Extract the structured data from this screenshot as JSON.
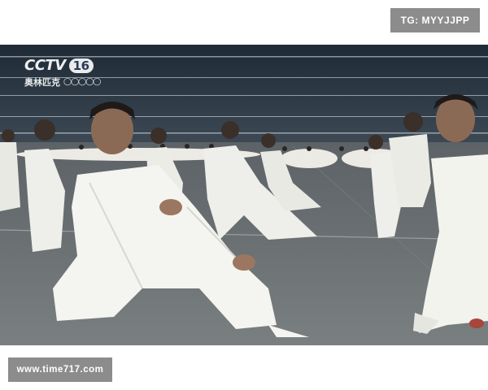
{
  "watermark_top_right": "TG: MYYJJPP",
  "watermark_bottom_left": "www.time717.com",
  "broadcast_logo": {
    "channel": "CCTV",
    "number": "16",
    "subtitle": "奥林匹克",
    "icon": "olympic-rings-icon"
  },
  "colors": {
    "badge_bg": "#8c8c8c",
    "floor": "#6e7375",
    "stands": "#34404a",
    "uniform": "#f2f2ee"
  }
}
